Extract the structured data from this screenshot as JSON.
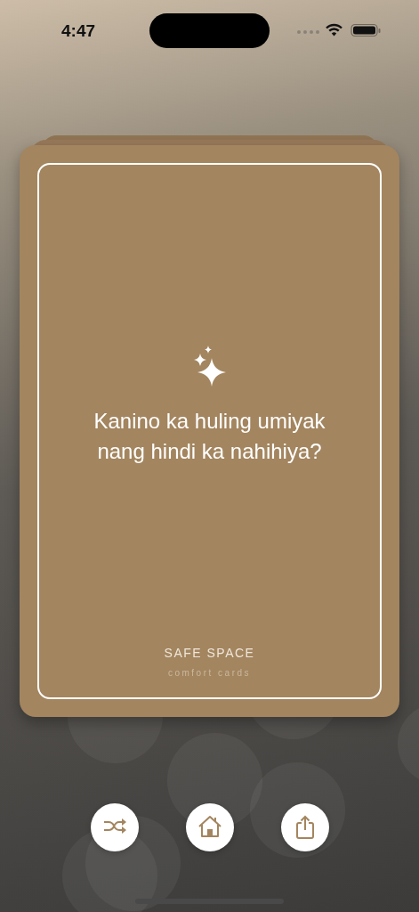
{
  "status_bar": {
    "time": "4:47"
  },
  "card": {
    "question": "Kanino ka huling umiyak nang hindi ka nahihiya?",
    "brand": "SAFE SPACE",
    "tagline": "comfort cards"
  },
  "buttons": [
    {
      "kind": "shuffle"
    },
    {
      "kind": "home"
    },
    {
      "kind": "share"
    }
  ]
}
